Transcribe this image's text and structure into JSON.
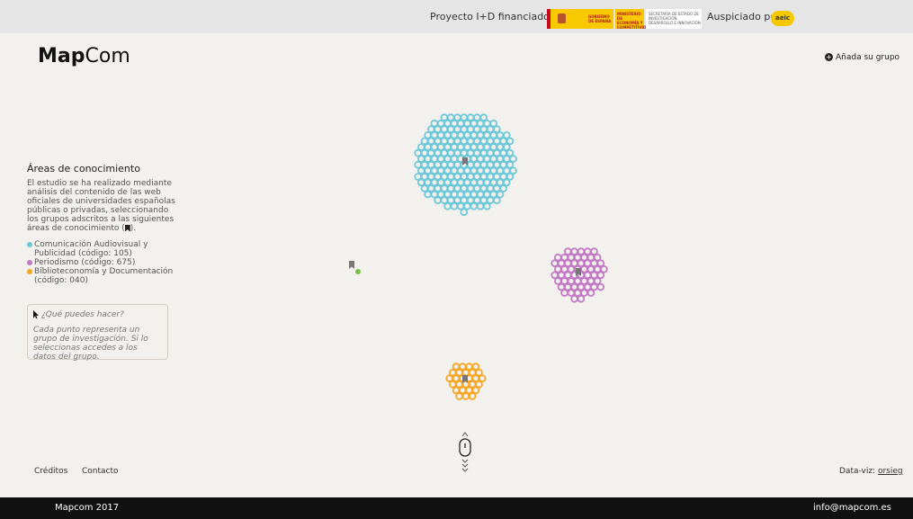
{
  "topbar": {
    "funded_label": "Proyecto I+D financiado por",
    "gov_text": "GOBIERNO DE ESPAÑA",
    "ministry_text": "MINISTERIO DE ECONOMÍA Y COMPETITIVIDAD",
    "secretary_text": "SECRETARÍA DE ESTADO DE INVESTIGACIÓN, DESARROLLO E INNOVACIÓN",
    "sponsor_label": "Auspiciado por",
    "sponsor_logo": "aeic"
  },
  "header": {
    "logo_bold": "Map",
    "logo_light": "Com",
    "add_group_label": "Añada su grupo"
  },
  "legend": {
    "title": "Áreas de conocimiento",
    "description": "El estudio se ha realizado mediante análisis del contenido de las web oficiales de universidades españolas públicas o privadas, seleccionando los grupos adscritos a las siguientes áreas de conocimiento (",
    "description_end": ").",
    "items": [
      {
        "label": "Comunicación Audiovisual y Publicidad (código: 105)",
        "color": "#6ec8d8"
      },
      {
        "label": "Periodismo (código: 675)",
        "color": "#c27ac4"
      },
      {
        "label": "Biblioteconomía y Documentación (código: 040)",
        "color": "#f5a623"
      }
    ]
  },
  "help": {
    "title": "¿Qué puedes hacer?",
    "text": "Cada punto representa un grupo de investigación. Si lo seleccionas accedes a los datos del grupo."
  },
  "clusters": [
    {
      "name": "Comunicación Audiovisual y Publicidad",
      "color": "#6ec8d8"
    },
    {
      "name": "Periodismo",
      "color": "#c27ac4"
    },
    {
      "name": "Biblioteconomía y Documentación",
      "color": "#f5a623"
    }
  ],
  "footer": {
    "credits": "Créditos",
    "contact": "Contacto",
    "dataviz_label": "Data-viz:",
    "dataviz_author": "orsieg"
  },
  "bottombar": {
    "copyright": "Mapcom 2017",
    "email": "info@mapcom.es"
  }
}
